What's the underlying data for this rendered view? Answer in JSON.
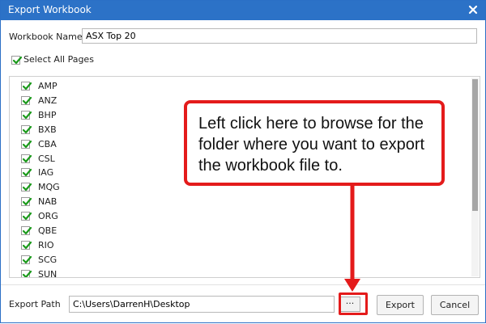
{
  "window": {
    "title": "Export Workbook"
  },
  "workbook": {
    "label": "Workbook Name",
    "value": "ASX Top 20"
  },
  "select_all": {
    "label": "Select All Pages",
    "checked": true
  },
  "pages": [
    {
      "label": "AMP",
      "checked": true
    },
    {
      "label": "ANZ",
      "checked": true
    },
    {
      "label": "BHP",
      "checked": true
    },
    {
      "label": "BXB",
      "checked": true
    },
    {
      "label": "CBA",
      "checked": true
    },
    {
      "label": "CSL",
      "checked": true
    },
    {
      "label": "IAG",
      "checked": true
    },
    {
      "label": "MQG",
      "checked": true
    },
    {
      "label": "NAB",
      "checked": true
    },
    {
      "label": "ORG",
      "checked": true
    },
    {
      "label": "QBE",
      "checked": true
    },
    {
      "label": "RIO",
      "checked": true
    },
    {
      "label": "SCG",
      "checked": true
    },
    {
      "label": "SUN",
      "checked": true
    }
  ],
  "export_path": {
    "label": "Export Path",
    "value": "C:\\Users\\DarrenH\\Desktop",
    "browse_label": "···"
  },
  "buttons": {
    "export": "Export",
    "cancel": "Cancel"
  },
  "annotation": {
    "text": "Left click here to browse for the folder where you want to export the workbook file to.",
    "color": "#e41b1b"
  },
  "colors": {
    "titlebar": "#2c72c7",
    "checkmark": "#1a9a1a"
  }
}
